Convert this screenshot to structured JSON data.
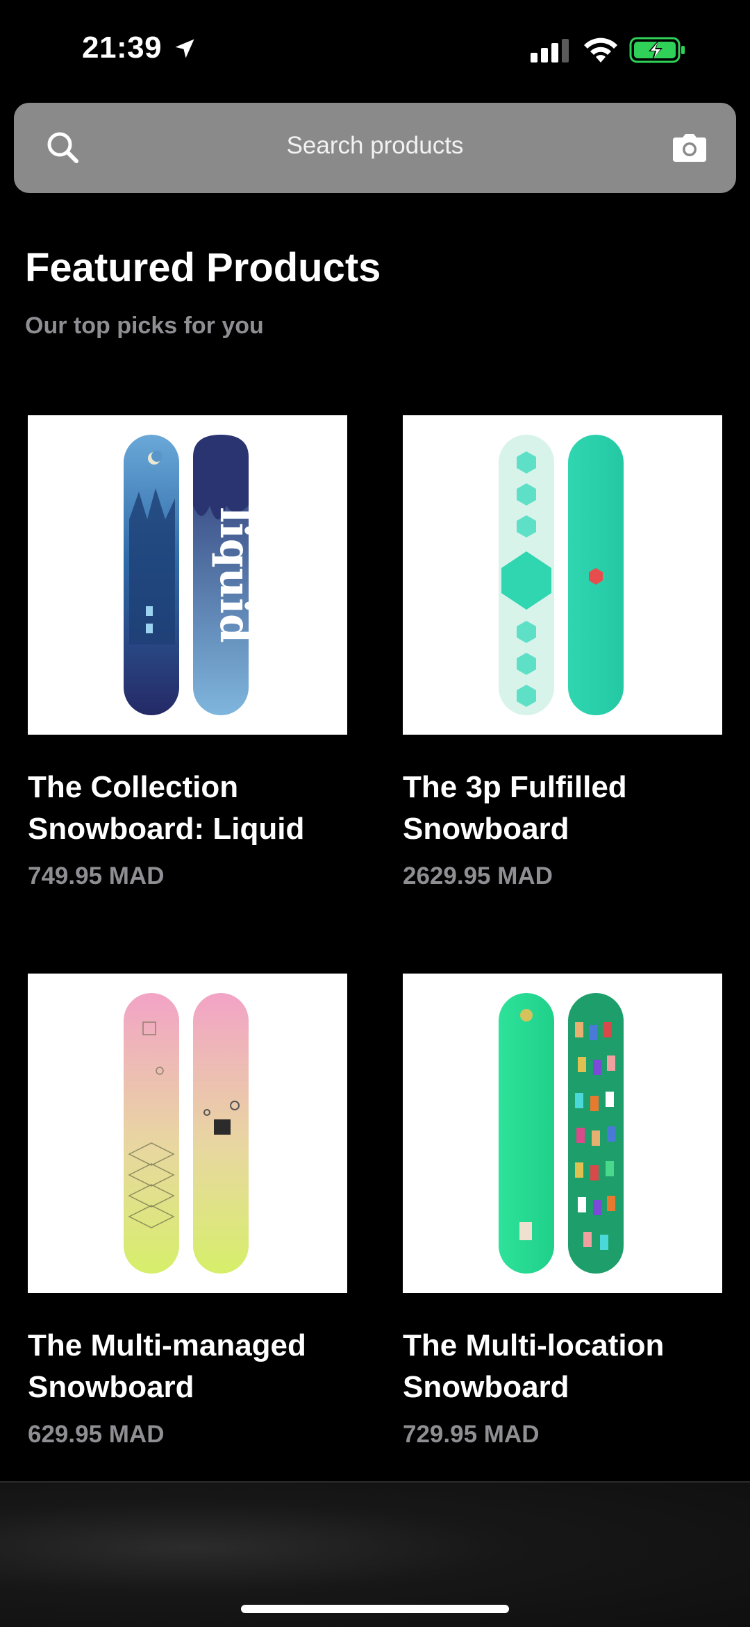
{
  "status_bar": {
    "time": "21:39"
  },
  "search": {
    "placeholder": "Search products"
  },
  "section": {
    "title": "Featured Products",
    "subtitle": "Our top picks for you"
  },
  "products": [
    {
      "title_line1": "The Collection",
      "title_line2": "Snowboard: Liquid",
      "price": "749.95 MAD",
      "board_text": "liquid"
    },
    {
      "title_line1": "The 3p Fulfilled",
      "title_line2": "Snowboard",
      "price": "2629.95 MAD"
    },
    {
      "title_line1": "The Multi-managed",
      "title_line2": "Snowboard",
      "price": "629.95 MAD"
    },
    {
      "title_line1": "The Multi-location",
      "title_line2": "Snowboard",
      "price": "729.95 MAD"
    }
  ],
  "colors": {
    "background": "#000000",
    "search_bar": "#8a8a8a",
    "secondary_text": "#8e8e93",
    "battery_green": "#30d158"
  }
}
